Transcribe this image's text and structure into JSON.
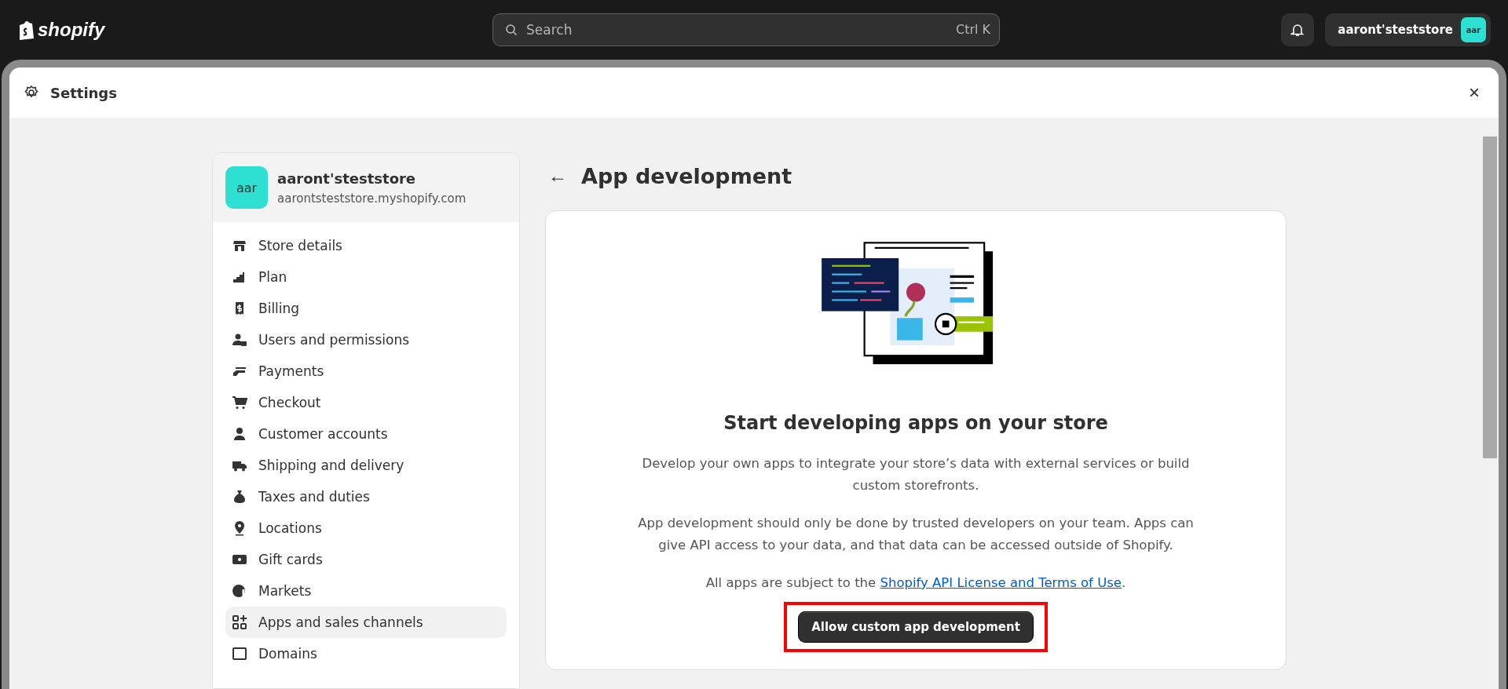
{
  "topbar": {
    "logo": "shopify",
    "search": {
      "placeholder": "Search",
      "shortcut": "Ctrl K"
    },
    "store": {
      "name": "aaront'steststore",
      "avatar": "aar"
    }
  },
  "modal": {
    "title": "Settings",
    "close": "×"
  },
  "sidebar": {
    "store": {
      "avatar": "aar",
      "name": "aaront'steststore",
      "domain": "aarontsteststore.myshopify.com"
    },
    "items": [
      {
        "label": "Store details",
        "selected": false
      },
      {
        "label": "Plan",
        "selected": false
      },
      {
        "label": "Billing",
        "selected": false
      },
      {
        "label": "Users and permissions",
        "selected": false
      },
      {
        "label": "Payments",
        "selected": false
      },
      {
        "label": "Checkout",
        "selected": false
      },
      {
        "label": "Customer accounts",
        "selected": false
      },
      {
        "label": "Shipping and delivery",
        "selected": false
      },
      {
        "label": "Taxes and duties",
        "selected": false
      },
      {
        "label": "Locations",
        "selected": false
      },
      {
        "label": "Gift cards",
        "selected": false
      },
      {
        "label": "Markets",
        "selected": false
      },
      {
        "label": "Apps and sales channels",
        "selected": true
      },
      {
        "label": "Domains",
        "selected": false
      }
    ]
  },
  "main": {
    "back": "←",
    "title": "App development",
    "card": {
      "heading": "Start developing apps on your store",
      "paragraphs": [
        "Develop your own apps to integrate your store’s data with external services or build custom storefronts.",
        "App development should only be done by trusted developers on your team. Apps can give API access to your data, and that data can be accessed outside of Shopify."
      ],
      "terms": {
        "before": "All apps are subject to the ",
        "link": "Shopify API License and Terms of Use",
        "after": "."
      },
      "button": {
        "label": "Allow custom app development",
        "highlighted": true
      }
    }
  }
}
